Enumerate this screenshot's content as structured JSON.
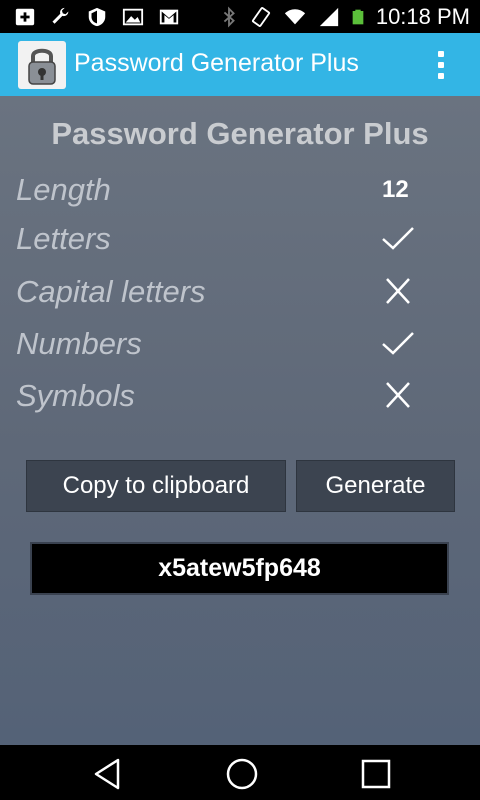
{
  "status_bar": {
    "time": "10:18 PM",
    "icons_left": [
      "add-box-icon",
      "wrench-icon",
      "shield-icon",
      "image-icon",
      "gmail-icon"
    ],
    "icons_right": [
      "bluetooth-icon",
      "vibrate-icon",
      "wifi-icon",
      "signal-icon",
      "battery-icon"
    ]
  },
  "action_bar": {
    "title": "Password Generator Plus",
    "app_icon": "padlock-icon",
    "menu_icon": "overflow-menu-icon",
    "color": "#33b5e5"
  },
  "main": {
    "heading": "Password Generator Plus",
    "options": [
      {
        "label": "Length",
        "value": "12"
      },
      {
        "label": "Letters",
        "state": "check"
      },
      {
        "label": "Capital letters",
        "state": "cross"
      },
      {
        "label": "Numbers",
        "state": "check"
      },
      {
        "label": "Symbols",
        "state": "cross"
      }
    ],
    "copy_label": "Copy to clipboard",
    "generate_label": "Generate",
    "password": "x5atew5fp648"
  },
  "nav_bar": {
    "icons": [
      "back-icon",
      "home-icon",
      "recent-apps-icon"
    ]
  }
}
